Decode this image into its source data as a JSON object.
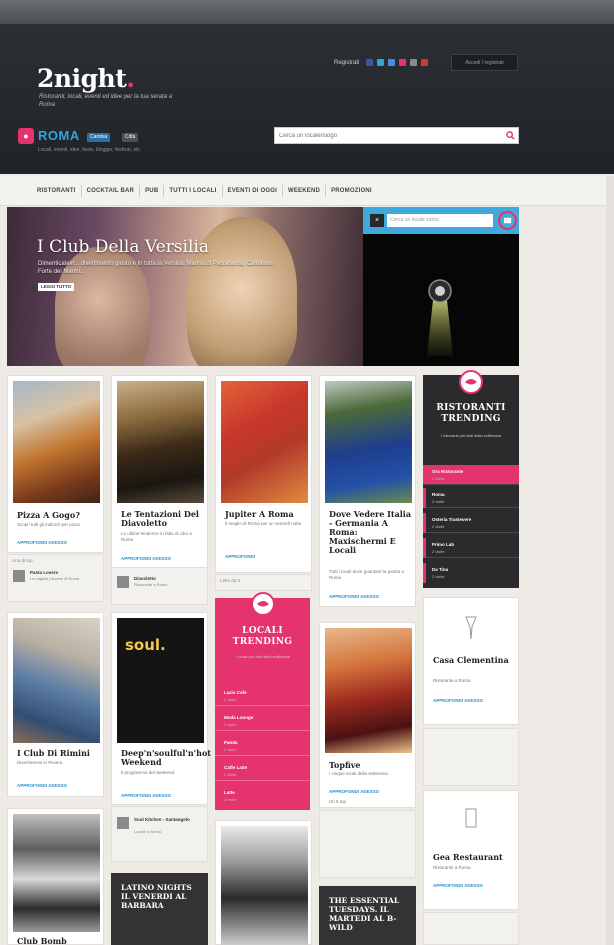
{
  "header": {
    "share_label": "Registrati",
    "register_button": "Accedi / registrati",
    "logo": "2night",
    "logo_dot": ".",
    "tagline": "Ristoranti, locali, eventi ed idee per la tua serata a Roma",
    "city": "ROMA",
    "city_tag_1": "Cambia",
    "city_tag_2": "Città",
    "city_sub": "Locali, eventi, idee, feste, blogger, festival, etc",
    "search_placeholder": "Cerca un locale/luogo"
  },
  "nav": [
    "RISTORANTI",
    "COCKTAIL BAR",
    "PUB",
    "TUTTI I LOCALI",
    "EVENTI DI OGGI",
    "WEEKEND",
    "PROMOZIONI"
  ],
  "hero": {
    "title": "I Club Della Versilia",
    "description": "Dimenticatevi... divertimento giusto e in tutta la Versilia: Marina di Pietrasanta, Camaiore, Forte dei Marmi...",
    "button": "LEGGI TUTTO"
  },
  "map": {
    "search_placeholder": "Cerca un locale vicino"
  },
  "cards": [
    {
      "title": "Pizza A Gogo?",
      "text": "Scopri tutti gli indirizzi per pizza",
      "link": "APPROFONDI ADESSO",
      "count": "Uno di top",
      "author": "Pasta Lovers",
      "author_desc": "Le migliori pizzerie di Roma"
    },
    {
      "title": "Le Tentazioni Del Diavoletto",
      "text": "Le ultime tendenze in fatto di cibo a Roma",
      "link": "APPROFONDI ADESSO",
      "author": "Diavoletto",
      "author_desc": "Ristorante a Roma"
    },
    {
      "title": "Jupiter A Roma",
      "text": "Il meglio di Roma per un venerdì notte",
      "link": "APPROFONDI",
      "count": "Letto da 0"
    },
    {
      "title": "Dove Vedere Italia - Germania A Roma: Maxischermi E Locali",
      "text": "Tutti i locali dove guardare la partita a Roma",
      "link": "APPROFONDI ADESSO"
    },
    {
      "title": "I Club Di Rimini",
      "text": "Divertimento in Riviera",
      "link": "APPROFONDI ADESSO"
    },
    {
      "title": "Deep'n'soulful'n'hot Weekend",
      "text": "Il programma del weekend",
      "link": "APPROFONDI ADESSO",
      "author": "Soul Kitchen - Santangelo",
      "author_desc": "Locale a Roma"
    },
    {
      "title": "Topfive",
      "text": "I cinque locali della settimana",
      "link": "APPROFONDI ADESSO",
      "count": "Un 5 top"
    },
    {
      "title": "Casa Clementina",
      "text": "Ristorante a Roma",
      "link": "APPROFONDI ADESSO"
    },
    {
      "title": "Gea Restaurant",
      "text": "Ristorante a Roma",
      "link": "APPROFONDI ADESSO"
    },
    {
      "title": "Club Bomb",
      "text": "",
      "link": ""
    }
  ],
  "trending_restaurants": {
    "title": "RISTORANTI TRENDING",
    "sub": "I ristoranti più visti della settimana",
    "rows": [
      {
        "name": "Ora Ristorante",
        "count": "2 visite"
      },
      {
        "name": "Roma",
        "count": "2 visite"
      },
      {
        "name": "Osteria Trastevere",
        "count": "2 visite"
      },
      {
        "name": "Primo Lab",
        "count": "2 visite"
      },
      {
        "name": "Da Tina",
        "count": "2 visite"
      }
    ]
  },
  "trending_locali": {
    "title": "LOCALI TRENDING",
    "sub": "I locali più visti della settimana",
    "rows": [
      {
        "name": "Lazio Cafe",
        "count": "2 visite"
      },
      {
        "name": "Moda Lounge",
        "count": "2 visite"
      },
      {
        "name": "Panda",
        "count": "2 visite"
      },
      {
        "name": "Caffe Latte",
        "count": "2 visite"
      },
      {
        "name": "Latte",
        "count": "2 visite"
      }
    ]
  },
  "dark_cards": [
    {
      "title": "LATINO NIGHTS IL VENERDI AL BARBARA"
    },
    {
      "title": "THE ESSENTIAL TUESDAYS. IL MARTEDI AL B-WILD"
    }
  ],
  "colors": {
    "accent": "#e5336d",
    "blue": "#3fa8dc",
    "dark": "#2b2b2d"
  }
}
